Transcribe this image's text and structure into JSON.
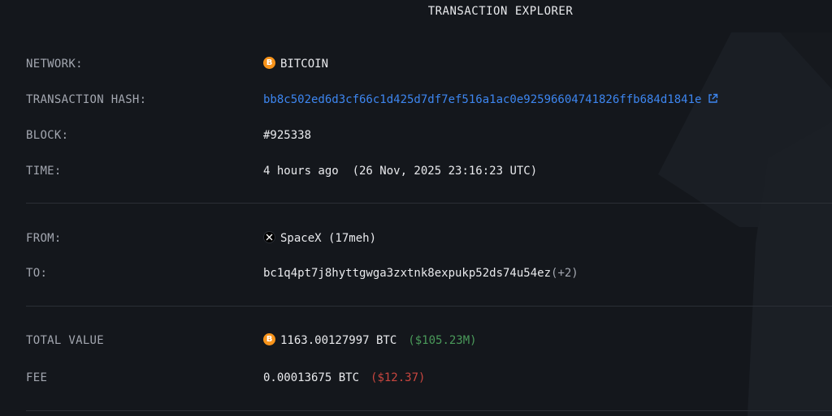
{
  "header": {
    "title": "TRANSACTION EXPLORER"
  },
  "fields": {
    "network": {
      "label": "NETWORK:",
      "value": "BITCOIN",
      "icon": "bitcoin-icon"
    },
    "hash": {
      "label": "TRANSACTION HASH:",
      "value": "bb8c502ed6d3cf66c1d425d7df7ef516a1ac0e92596604741826ffb684d1841e",
      "icon": "external-link-icon"
    },
    "block": {
      "label": "BLOCK:",
      "value": "#925338"
    },
    "time": {
      "label": "TIME:",
      "relative": "4 hours ago",
      "absolute": "(26 Nov, 2025 23:16:23 UTC)"
    },
    "from": {
      "label": "FROM:",
      "value": "SpaceX (17meh)",
      "icon": "x-logo-icon"
    },
    "to": {
      "label": "TO:",
      "value": "bc1q4pt7j8hyttgwga3zxtnk8expukp52ds74u54ez",
      "extra": "(+2)"
    },
    "total_value": {
      "label": "TOTAL VALUE",
      "amount": "1163.00127997 BTC",
      "usd": "($105.23M)",
      "icon": "bitcoin-icon"
    },
    "fee": {
      "label": "FEE",
      "amount": "0.00013675 BTC",
      "usd": "($12.37)"
    }
  },
  "colors": {
    "background": "#14171c",
    "link": "#3d86f0",
    "positive": "#4a9a5a",
    "negative": "#c8463f",
    "bitcoin": "#f7931a"
  }
}
